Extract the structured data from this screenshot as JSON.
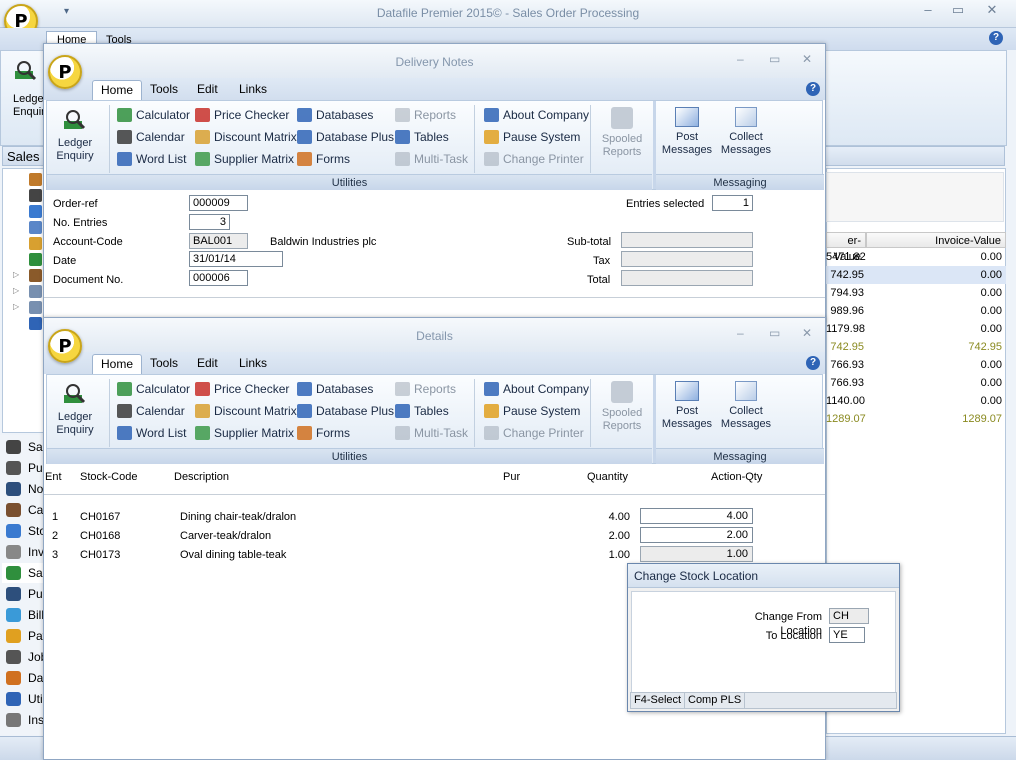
{
  "app": {
    "title": "Datafile  Premier 2015© - Sales Order Processing",
    "logo_letter": "P",
    "tabs": [
      "Home",
      "Tools"
    ],
    "ribbon_ledger_label": "Ledger Enquiry",
    "sales_label": "Sales"
  },
  "left_nav": [
    "Sa",
    "Pu",
    "No",
    "Ca",
    "Sto",
    "Inv",
    "Sa",
    "Pu",
    "Bill",
    "Pay",
    "Job",
    "Da",
    "Uti",
    "Ins"
  ],
  "right_values": {
    "headers": [
      "er-Value",
      "Invoice-Value"
    ],
    "rows": [
      {
        "a": "5471.82",
        "b": "0.00"
      },
      {
        "a": "742.95",
        "b": "0.00",
        "selected": true
      },
      {
        "a": "794.93",
        "b": "0.00"
      },
      {
        "a": "989.96",
        "b": "0.00"
      },
      {
        "a": "1179.98",
        "b": "0.00"
      },
      {
        "a": "742.95",
        "b": "742.95",
        "highlight": true
      },
      {
        "a": "766.93",
        "b": "0.00"
      },
      {
        "a": "766.93",
        "b": "0.00"
      },
      {
        "a": "1140.00",
        "b": "0.00"
      },
      {
        "a": "1289.07",
        "b": "1289.07",
        "highlight": true
      }
    ]
  },
  "ribbon": {
    "tabs": [
      "Home",
      "Tools",
      "Edit",
      "Links"
    ],
    "ledger": "Ledger Enquiry",
    "col1": [
      "Calculator",
      "Calendar",
      "Word List"
    ],
    "col2": [
      "Price Checker",
      "Discount Matrix",
      "Supplier Matrix"
    ],
    "col3": [
      "Databases",
      "Database Plus",
      "Forms"
    ],
    "col4": [
      "Reports",
      "Tables",
      "Multi-Task"
    ],
    "col5": [
      "About Company",
      "Pause System",
      "Change Printer"
    ],
    "spooled": "Spooled Reports",
    "post": "Post Messages",
    "collect": "Collect Messages",
    "utilities_label": "Utilities",
    "messaging_label": "Messaging"
  },
  "delivery": {
    "title": "Delivery Notes",
    "order_ref_label": "Order-ref",
    "order_ref": "000009",
    "entries_label": "No. Entries",
    "entries": "3",
    "account_label": "Account-Code",
    "account": "BAL001",
    "account_name": "Baldwin Industries plc",
    "date_label": "Date",
    "date": "31/01/14",
    "docno_label": "Document No.",
    "docno": "000006",
    "entries_selected_label": "Entries selected",
    "entries_selected": "1",
    "subtotal_label": "Sub-total",
    "tax_label": "Tax",
    "total_label": "Total"
  },
  "details": {
    "title": "Details",
    "headers": [
      "Ent",
      "Stock-Code",
      "Description",
      "Pur",
      "Quantity",
      "Action-Qty"
    ],
    "rows": [
      {
        "ent": "1",
        "code": "CH0167",
        "desc": "Dining chair-teak/dralon",
        "qty": "4.00",
        "action": "4.00"
      },
      {
        "ent": "2",
        "code": "CH0168",
        "desc": "Carver-teak/dralon",
        "qty": "2.00",
        "action": "2.00"
      },
      {
        "ent": "3",
        "code": "CH0173",
        "desc": "Oval dining table-teak",
        "qty": "1.00",
        "action": "1.00"
      }
    ]
  },
  "dialog": {
    "title": "Change Stock Location",
    "from_label": "Change From Location",
    "from_value": "CH",
    "to_label": "To Location",
    "to_value": "YE",
    "status": [
      "F4-Select",
      "Comp PLS"
    ]
  }
}
